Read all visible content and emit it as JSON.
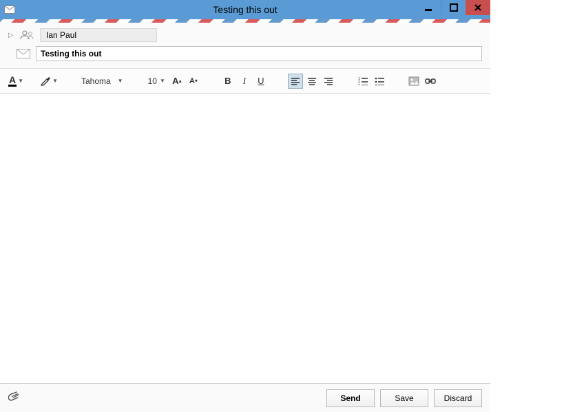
{
  "window": {
    "title": "Testing this out"
  },
  "recipient": {
    "name": "Ian Paul"
  },
  "subject": {
    "value": "Testing this out"
  },
  "toolbar": {
    "font_family": "Tahoma",
    "font_size": "10",
    "font_increase": "A",
    "font_decrease": "A",
    "bold": "B",
    "italic": "I",
    "underline": "U"
  },
  "footer": {
    "send": "Send",
    "save": "Save",
    "discard": "Discard"
  }
}
